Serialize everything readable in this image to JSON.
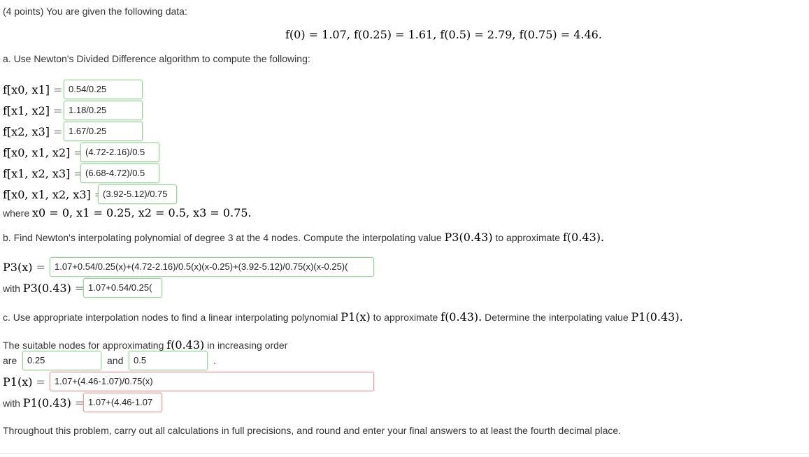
{
  "header": {
    "intro": "(4 points) You are given the following data:"
  },
  "given": {
    "equation": "f(0) = 1.07,   f(0.25) = 1.61,   f(0.5) = 2.79,   f(0.75) = 4.46."
  },
  "part_a": {
    "prompt": "a. Use Newton's Divided Difference algorithm to compute the following:",
    "rows": [
      {
        "label": "f[x0, x1]",
        "value": "0.54/0.25"
      },
      {
        "label": "f[x1, x2]",
        "value": "1.18/0.25"
      },
      {
        "label": "f[x2, x3]",
        "value": "1.67/0.25"
      },
      {
        "label": "f[x0, x1, x2]",
        "value": "(4.72-2.16)/0.5"
      },
      {
        "label": "f[x1, x2, x3]",
        "value": "(6.68-4.72)/0.5"
      },
      {
        "label": "f[x0, x1, x2, x3]",
        "value": "(3.92-5.12)/0.75"
      }
    ],
    "where_text": "where",
    "where_math": "x0 = 0, x1 = 0.25, x2 = 0.5, x3 = 0.75."
  },
  "part_b": {
    "prompt": "b. Find Newton's interpolating polynomial of degree 3 at the 4 nodes. Compute the interpolating value",
    "prompt_math1": "P3(0.43)",
    "prompt_mid": "to approximate",
    "prompt_math2": "f(0.43).",
    "p3_label": "P3(x)",
    "p3_value": "1.07+0.54/0.25(x)+(4.72-2.16)/0.5(x)(x-0.25)+(3.92-5.12)/0.75(x)(x-0.25)(",
    "with_text": "with",
    "p3_at_label": "P3(0.43)",
    "p3_at_value": "1.07+0.54/0.25("
  },
  "part_c": {
    "prompt": "c. Use appropriate interpolation nodes to find a linear interpolating polynomial",
    "prompt_math1": "P1(x)",
    "prompt_mid1": "to approximate",
    "prompt_math2": "f(0.43).",
    "prompt_mid2": "Determine the interpolating value",
    "prompt_math3": "P1(0.43).",
    "nodes_text": "The suitable nodes for approximating",
    "nodes_math": "f(0.43)",
    "nodes_suffix": "in increasing order",
    "are_text": "are",
    "node1": "0.25",
    "and_text": "and",
    "node2": "0.5",
    "period": ".",
    "p1_label": "P1(x)",
    "p1_value": "1.07+(4.46-1.07)/0.75(x)",
    "with_text": "with",
    "p1_at_label": "P1(0.43)",
    "p1_at_value": "1.07+(4.46-1.07"
  },
  "footer": {
    "note": "Throughout this problem, carry out all calculations in full precisions, and round and enter your final answers to at least the fourth decimal place."
  }
}
